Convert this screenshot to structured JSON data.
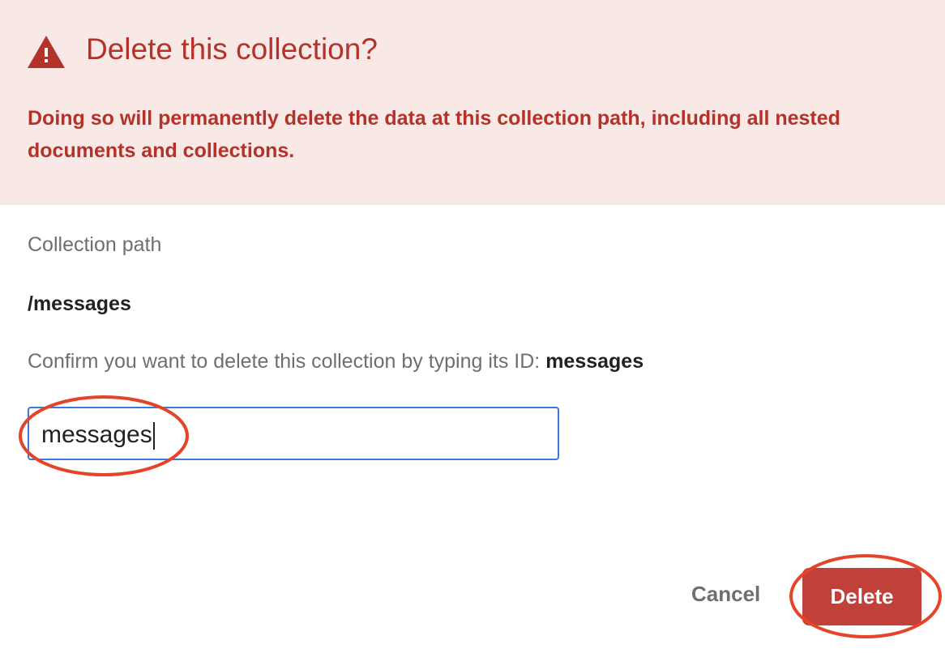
{
  "dialog": {
    "title": "Delete this collection?",
    "warning_icon": "warning-triangle-icon",
    "description": "Doing so will permanently delete the data at this collection path, including all nested documents and collections.",
    "path_label": "Collection path",
    "path_value": "/messages",
    "confirm_prefix": "Confirm you want to delete this collection by typing its ID: ",
    "confirm_id": "messages",
    "input_value": "messages",
    "cancel_label": "Cancel",
    "delete_label": "Delete"
  },
  "colors": {
    "accent": "#b3332b",
    "header_bg": "#f8e8e6",
    "delete_bg": "#c1403a",
    "focus": "#3a78e0",
    "annotation": "#e5442a"
  }
}
